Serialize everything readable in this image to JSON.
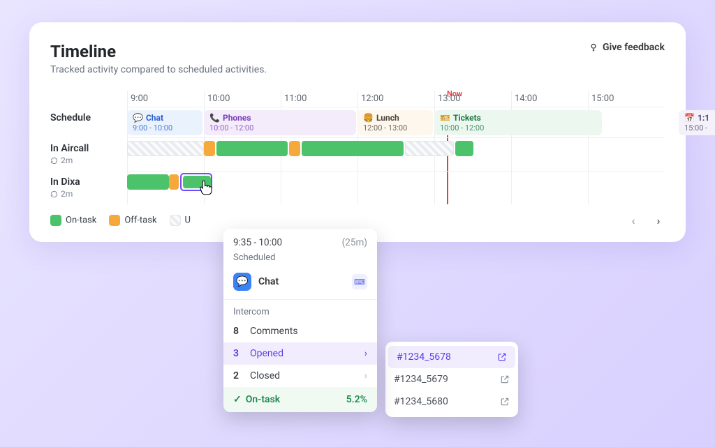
{
  "header": {
    "title": "Timeline",
    "subtitle": "Tracked activity compared to scheduled activities.",
    "feedback": "Give feedback"
  },
  "hours": [
    "9:00",
    "10:00",
    "11:00",
    "12:00",
    "13:00",
    "14:00",
    "15:00"
  ],
  "now_label": "Now",
  "schedule": {
    "label": "Schedule",
    "chat": {
      "title": "Chat",
      "range": "9:00 - 10:00",
      "icon": "💬"
    },
    "phones": {
      "title": "Phones",
      "range": "10:00 - 12:00",
      "icon": "📞"
    },
    "lunch": {
      "title": "Lunch",
      "range": "12:00 - 13:00",
      "icon": "🍔"
    },
    "tickets": {
      "title": "Tickets",
      "range": "10:00 - 12:00",
      "icon": "🎫"
    },
    "oneonone": {
      "title": "1:1",
      "range": "15:00 -",
      "icon": "📅"
    }
  },
  "rows": {
    "aircall": {
      "label": "In Aircall",
      "sub": "2m"
    },
    "dixa": {
      "label": "In Dixa",
      "sub": "2m"
    }
  },
  "legend": {
    "on": "On-task",
    "off": "Off-task",
    "un": "U"
  },
  "popover": {
    "time": "9:35 - 10:00",
    "dur": "(25m)",
    "scheduled": "Scheduled",
    "channel": "Chat",
    "section": "Intercom",
    "comments": {
      "count": "8",
      "label": "Comments"
    },
    "opened": {
      "count": "3",
      "label": "Opened"
    },
    "closed": {
      "count": "2",
      "label": "Closed"
    },
    "ontask_label": "On-task",
    "ontask_pct": "5.2%"
  },
  "tickets_list": [
    "#1234_5678",
    "#1234_5679",
    "#1234_5680"
  ]
}
